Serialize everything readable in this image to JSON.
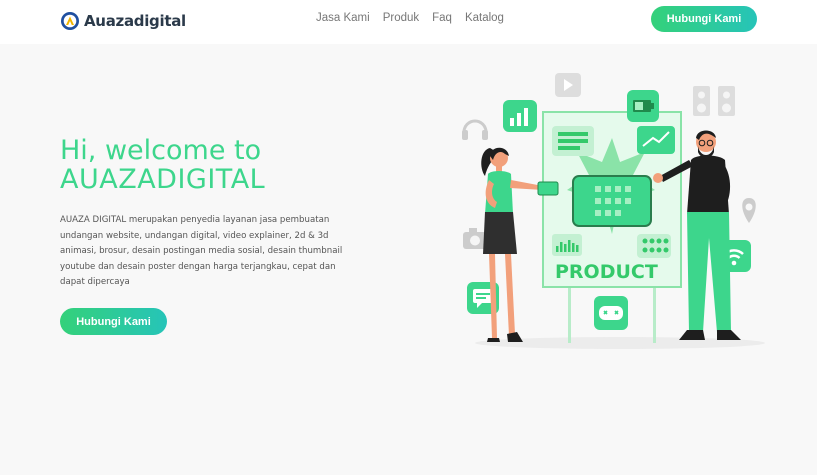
{
  "brand": {
    "name": "Auazadigital",
    "logo_icon": "auaza-logo-icon"
  },
  "nav": {
    "items": [
      "Jasa Kami",
      "Produk",
      "Faq",
      "Katalog"
    ]
  },
  "header_cta": {
    "label": "Hubungi Kami"
  },
  "hero": {
    "title_line1": "Hi, welcome to",
    "title_line2": "AUAZADIGITAL",
    "description": "AUAZA DIGITAL merupakan penyedia layanan jasa pembuatan undangan website, undangan digital, video explainer, 2d & 3d animasi, brosur, desain postingan media sosial, desain thumbnail youtube dan desain poster dengan harga terjangkau, cepat dan dapat dipercaya",
    "cta_label": "Hubungi Kami"
  },
  "illustration": {
    "board_text": "PRODUCT",
    "icons": [
      "youtube-icon",
      "bar-chart-icon",
      "battery-icon",
      "speaker-icon",
      "headphones-icon",
      "trend-chart-icon",
      "location-pin-icon",
      "camera-icon",
      "wifi-icon",
      "chat-bubble-icon",
      "gamepad-icon"
    ]
  },
  "colors": {
    "accent": "#3dd68c",
    "gradient_start": "#34d17a",
    "gradient_end": "#26c4b8",
    "navbar_bg": "#ffffff",
    "page_bg": "#f8f8f8"
  }
}
